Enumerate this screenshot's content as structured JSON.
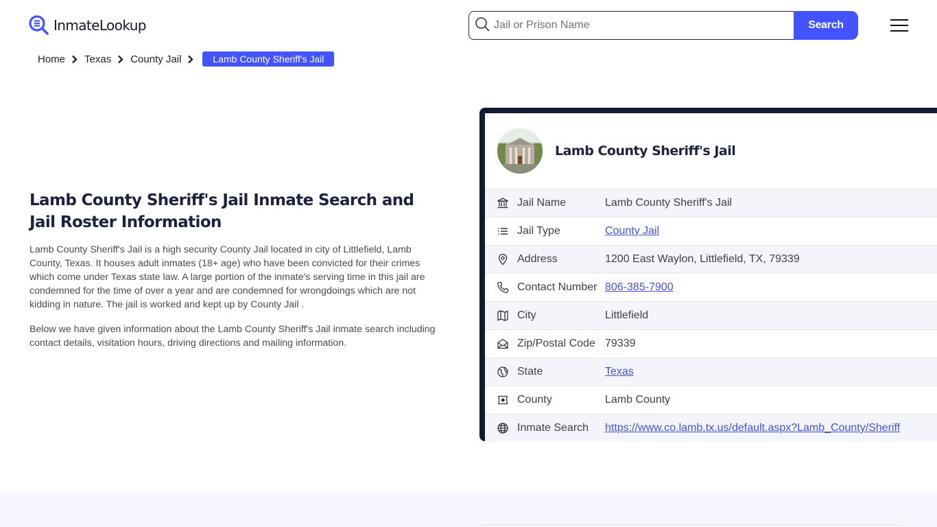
{
  "header": {
    "logo_text": "InmateLookup",
    "search": {
      "placeholder": "Jail or Prison Name",
      "value": "",
      "button_label": "Search"
    },
    "menu_icon": "hamburger-menu-icon"
  },
  "breadcrumb": {
    "items": [
      "Home",
      "Texas",
      "County Jail"
    ],
    "current": "Lamb County Sheriff's Jail"
  },
  "intro": {
    "title": "Lamb County Sheriff's Jail Inmate Search and Jail Roster Information",
    "paragraphs": [
      "Lamb County Sheriff's Jail is a high security County Jail located in city of Littlefield, Lamb County, Texas. It houses adult inmates (18+ age) who have been convicted for their crimes which come under Texas state law. A large portion of the inmate's serving time in this jail are condemned for the time of over a year and are condemned for wrongdoings which are not kidding in nature. The jail is worked and kept up by County Jail .",
      "Below we have given information about the Lamb County Sheriff's Jail inmate search including contact details, visitation hours, driving directions and mailing information."
    ]
  },
  "card": {
    "title": "Lamb County Sheriff's Jail",
    "rows": [
      {
        "icon": "building-icon",
        "label": "Jail Name",
        "value": "Lamb County Sheriff's Jail",
        "link": false
      },
      {
        "icon": "list-icon",
        "label": "Jail Type",
        "value": "County Jail",
        "link": true
      },
      {
        "icon": "map-pin-icon",
        "label": "Address",
        "value": "1200 East Waylon, Littlefield, TX, 79339",
        "link": false
      },
      {
        "icon": "phone-icon",
        "label": "Contact Number",
        "value": "806-385-7900",
        "link": true
      },
      {
        "icon": "map-icon",
        "label": "City",
        "value": "Littlefield",
        "link": false
      },
      {
        "icon": "mail-open-icon",
        "label": "Zip/Postal Code",
        "value": "79339",
        "link": false
      },
      {
        "icon": "state-globe-icon",
        "label": "State",
        "value": "Texas",
        "link": true
      },
      {
        "icon": "county-map-icon",
        "label": "County",
        "value": "Lamb County",
        "link": false
      },
      {
        "icon": "globe-icon",
        "label": "Inmate Search",
        "value": "https://www.co.lamb.tx.us/default.aspx?Lamb_County/Sheriff",
        "link": true
      }
    ]
  },
  "colors": {
    "accent": "#4353ff",
    "heading": "#1b2240",
    "card_border": "#111a2e",
    "link": "#4353d6"
  }
}
